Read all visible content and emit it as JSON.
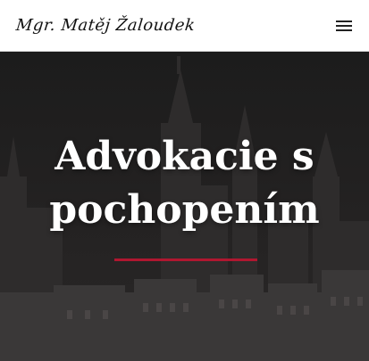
{
  "header": {
    "logo_text": "Mgr. Matěj Žaloudek",
    "menu_icon": "hamburger-menu-icon"
  },
  "hero": {
    "title_line1": "Advokacie s",
    "title_line2": "pochopením",
    "accent_color": "#b01730"
  }
}
